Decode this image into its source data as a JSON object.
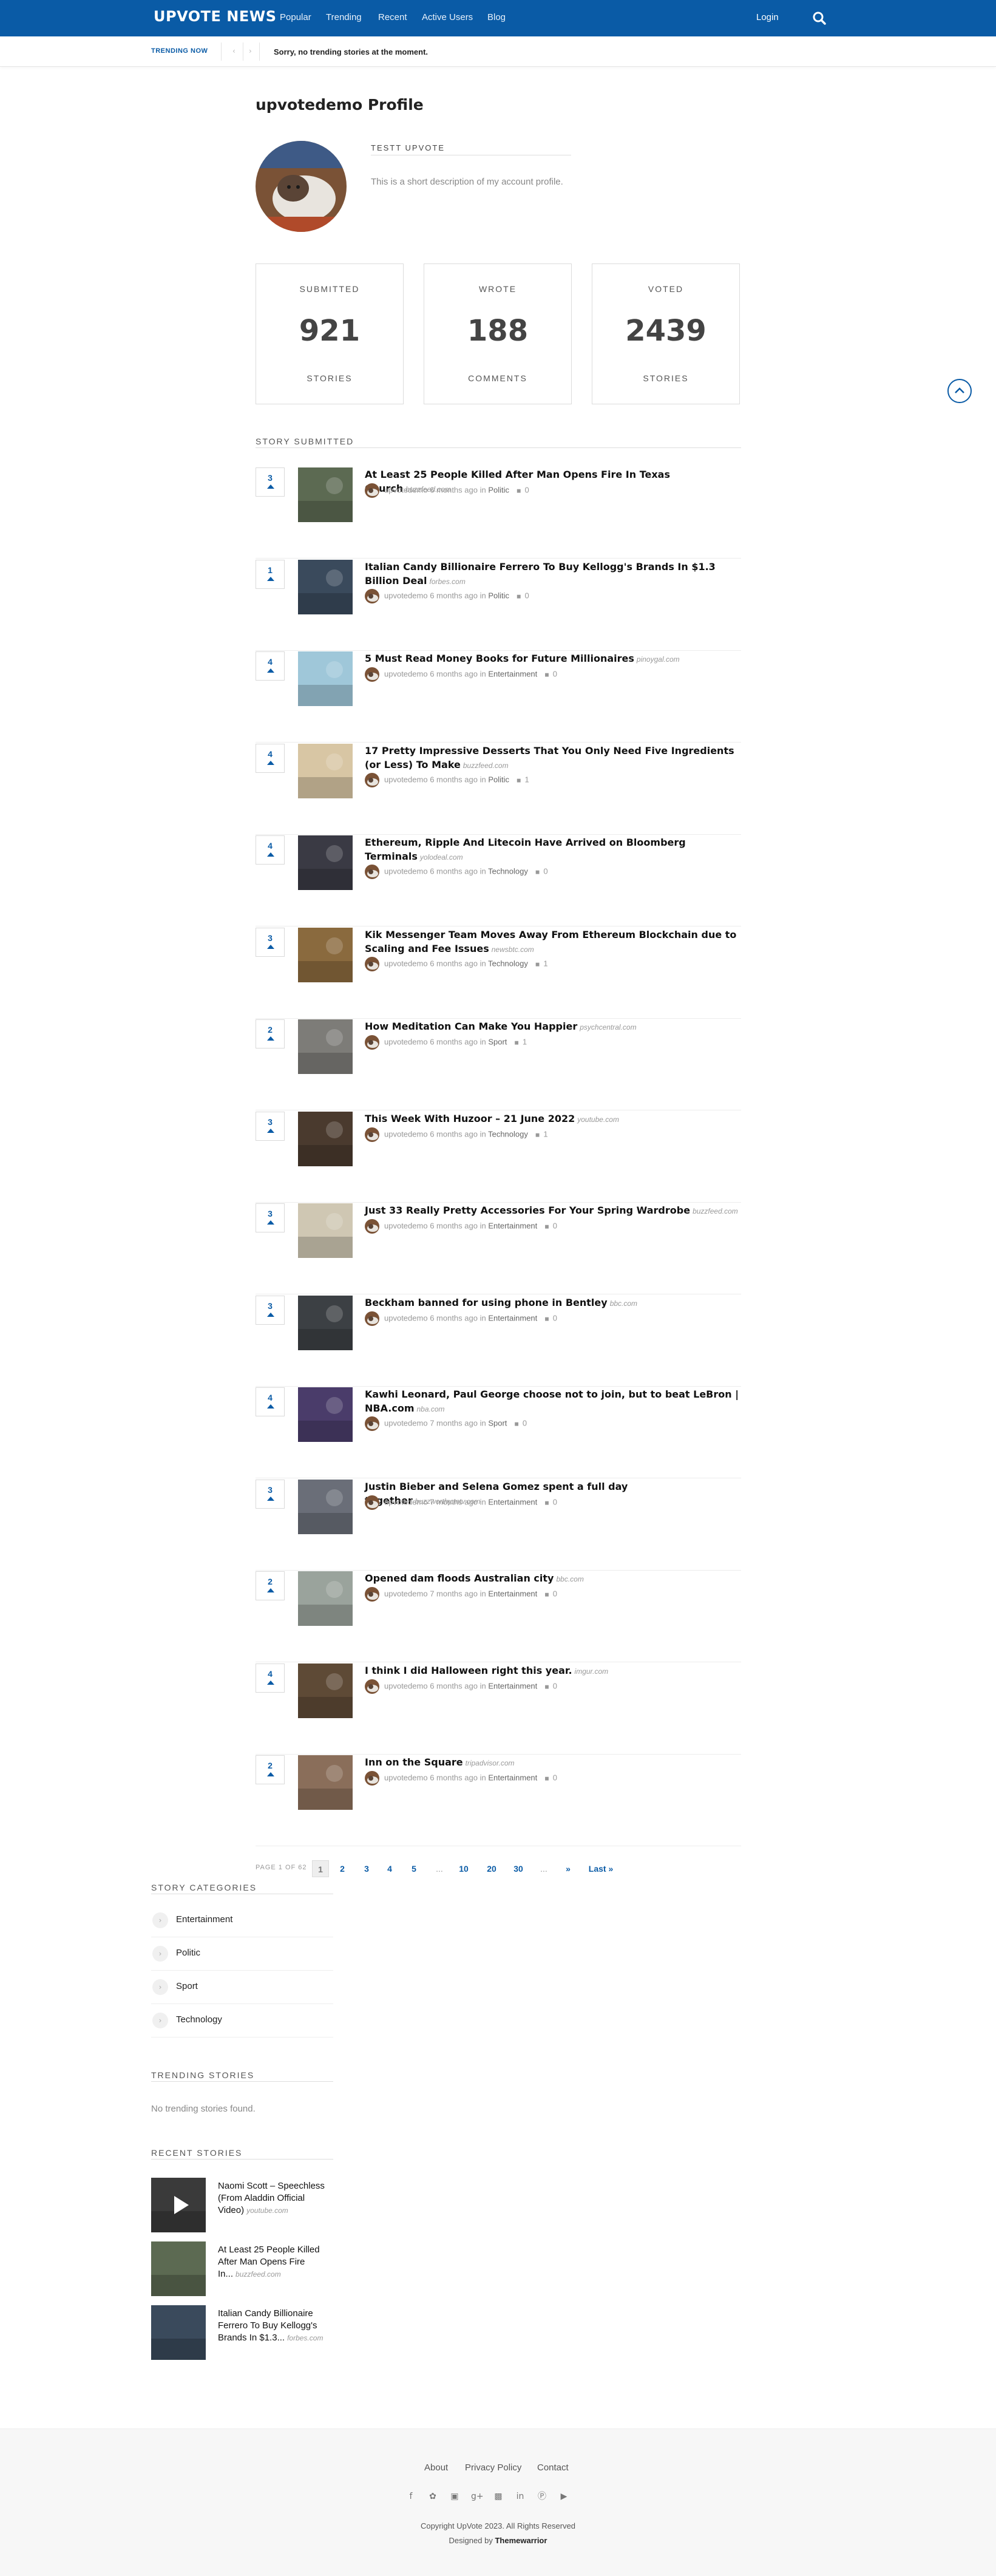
{
  "header": {
    "brand": "UPVOTE NEWS",
    "nav": [
      "Popular",
      "Trending",
      "Recent",
      "Active Users",
      "Blog"
    ],
    "login": "Login",
    "search_icon": "search-icon"
  },
  "trending_bar": {
    "label": "TRENDING NOW",
    "message": "Sorry, no trending stories at the moment."
  },
  "profile": {
    "title": "upvotedemo Profile",
    "name": "TESTT UPVOTE",
    "description": "This is a short description of my account profile."
  },
  "stats": [
    {
      "label": "SUBMITTED",
      "value": "921",
      "unit": "STORIES"
    },
    {
      "label": "WROTE",
      "value": "188",
      "unit": "COMMENTS"
    },
    {
      "label": "VOTED",
      "value": "2439",
      "unit": "STORIES"
    }
  ],
  "stories_section": {
    "title": "STORY SUBMITTED"
  },
  "stories": [
    {
      "votes": "3",
      "title": "At Least 25 People Killed After Man Opens Fire In Texas Church",
      "domain": "buzzfeed.com",
      "author": "upvotedemo",
      "time": "6 months ago in",
      "category": "Politic",
      "comments": "0",
      "thumb_color": "#5c6a52"
    },
    {
      "votes": "1",
      "title": "Italian Candy Billionaire Ferrero To Buy Kellogg's Brands In $1.3 Billion Deal",
      "domain": "forbes.com",
      "author": "upvotedemo",
      "time": "6 months ago in",
      "category": "Politic",
      "comments": "0",
      "thumb_color": "#3a4a5c"
    },
    {
      "votes": "4",
      "title": "5 Must Read Money Books for Future Millionaires",
      "domain": "pinoygal.com",
      "author": "upvotedemo",
      "time": "6 months ago in",
      "category": "Entertainment",
      "comments": "0",
      "thumb_color": "#9fc7d9"
    },
    {
      "votes": "4",
      "title": "17 Pretty Impressive Desserts That You Only Need Five Ingredients (or Less) To Make",
      "domain": "buzzfeed.com",
      "author": "upvotedemo",
      "time": "6 months ago in",
      "category": "Politic",
      "comments": "1",
      "thumb_color": "#d8c6a4"
    },
    {
      "votes": "4",
      "title": "Ethereum, Ripple And Litecoin Have Arrived on Bloomberg Terminals",
      "domain": "yolodeal.com",
      "author": "upvotedemo",
      "time": "6 months ago in",
      "category": "Technology",
      "comments": "0",
      "thumb_color": "#3a3a44"
    },
    {
      "votes": "3",
      "title": "Kik Messenger Team Moves Away From Ethereum Blockchain due to Scaling and Fee Issues",
      "domain": "newsbtc.com",
      "author": "upvotedemo",
      "time": "6 months ago in",
      "category": "Technology",
      "comments": "1",
      "thumb_color": "#8a6a3e"
    },
    {
      "votes": "2",
      "title": "How Meditation Can Make You Happier",
      "domain": "psychcentral.com",
      "author": "upvotedemo",
      "time": "6 months ago in",
      "category": "Sport",
      "comments": "1",
      "thumb_color": "#7d7c78"
    },
    {
      "votes": "3",
      "title": "This Week With Huzoor – 21 June 2022",
      "domain": "youtube.com",
      "author": "upvotedemo",
      "time": "6 months ago in",
      "category": "Technology",
      "comments": "1",
      "thumb_color": "#4a3a2e"
    },
    {
      "votes": "3",
      "title": "Just 33 Really Pretty Accessories For Your Spring Wardrobe",
      "domain": "buzzfeed.com",
      "author": "upvotedemo",
      "time": "6 months ago in",
      "category": "Entertainment",
      "comments": "0",
      "thumb_color": "#cfc7b3"
    },
    {
      "votes": "3",
      "title": "Beckham banned for using phone in Bentley",
      "domain": "bbc.com",
      "author": "upvotedemo",
      "time": "6 months ago in",
      "category": "Entertainment",
      "comments": "0",
      "thumb_color": "#3c4044"
    },
    {
      "votes": "4",
      "title": "Kawhi Leonard, Paul George choose not to join, but to beat LeBron | NBA.com",
      "domain": "nba.com",
      "author": "upvotedemo",
      "time": "7 months ago in",
      "category": "Sport",
      "comments": "0",
      "thumb_color": "#4a3c6a"
    },
    {
      "votes": "3",
      "title": "Justin Bieber and Selena Gomez spent a full day together",
      "domain": "buzzworthy.mtv.com",
      "author": "upvotedemo",
      "time": "7 months ago in",
      "category": "Entertainment",
      "comments": "0",
      "thumb_color": "#6a6e78"
    },
    {
      "votes": "2",
      "title": "Opened dam floods Australian city",
      "domain": "bbc.com",
      "author": "upvotedemo",
      "time": "7 months ago in",
      "category": "Entertainment",
      "comments": "0",
      "thumb_color": "#9aa39c"
    },
    {
      "votes": "4",
      "title": "I think I did Halloween right this year.",
      "domain": "imgur.com",
      "author": "upvotedemo",
      "time": "6 months ago in",
      "category": "Entertainment",
      "comments": "0",
      "thumb_color": "#5e4a36"
    },
    {
      "votes": "2",
      "title": "Inn on the Square",
      "domain": "tripadvisor.com",
      "author": "upvotedemo",
      "time": "6 months ago in",
      "category": "Entertainment",
      "comments": "0",
      "thumb_color": "#8a6e5a"
    }
  ],
  "pagination": {
    "prefix": "PAGE 1 OF 62",
    "items": [
      "1",
      "2",
      "3",
      "4",
      "5",
      "...",
      "10",
      "20",
      "30",
      "...",
      "»",
      "Last »"
    ]
  },
  "sidebar": {
    "categories_title": "STORY CATEGORIES",
    "categories": [
      "Entertainment",
      "Politic",
      "Sport",
      "Technology"
    ],
    "trending_title": "TRENDING STORIES",
    "trending_empty": "No trending stories found.",
    "recent_title": "RECENT STORIES",
    "recent": [
      {
        "title": "Naomi Scott – Speechless (From Aladdin Official Video)",
        "domain": "youtube.com",
        "thumb_color": "#3a3a3a"
      },
      {
        "title": "At Least 25 People Killed After Man Opens Fire In...",
        "domain": "buzzfeed.com",
        "thumb_color": "#5c6a52"
      },
      {
        "title": "Italian Candy Billionaire Ferrero To Buy Kellogg's Brands In $1.3...",
        "domain": "forbes.com",
        "thumb_color": "#3a4a5c"
      }
    ]
  },
  "footer": {
    "links": [
      "About",
      "Privacy Policy",
      "Contact"
    ],
    "social_icons": [
      "facebook-icon",
      "twitter-icon",
      "instagram-icon",
      "google-plus-icon",
      "flickr-icon",
      "linkedin-icon",
      "pinterest-icon",
      "youtube-icon"
    ],
    "copyright": "Copyright UpVote 2023. All Rights Reserved",
    "designed_prefix": "Designed by",
    "designed_by": "Themewarrior"
  }
}
